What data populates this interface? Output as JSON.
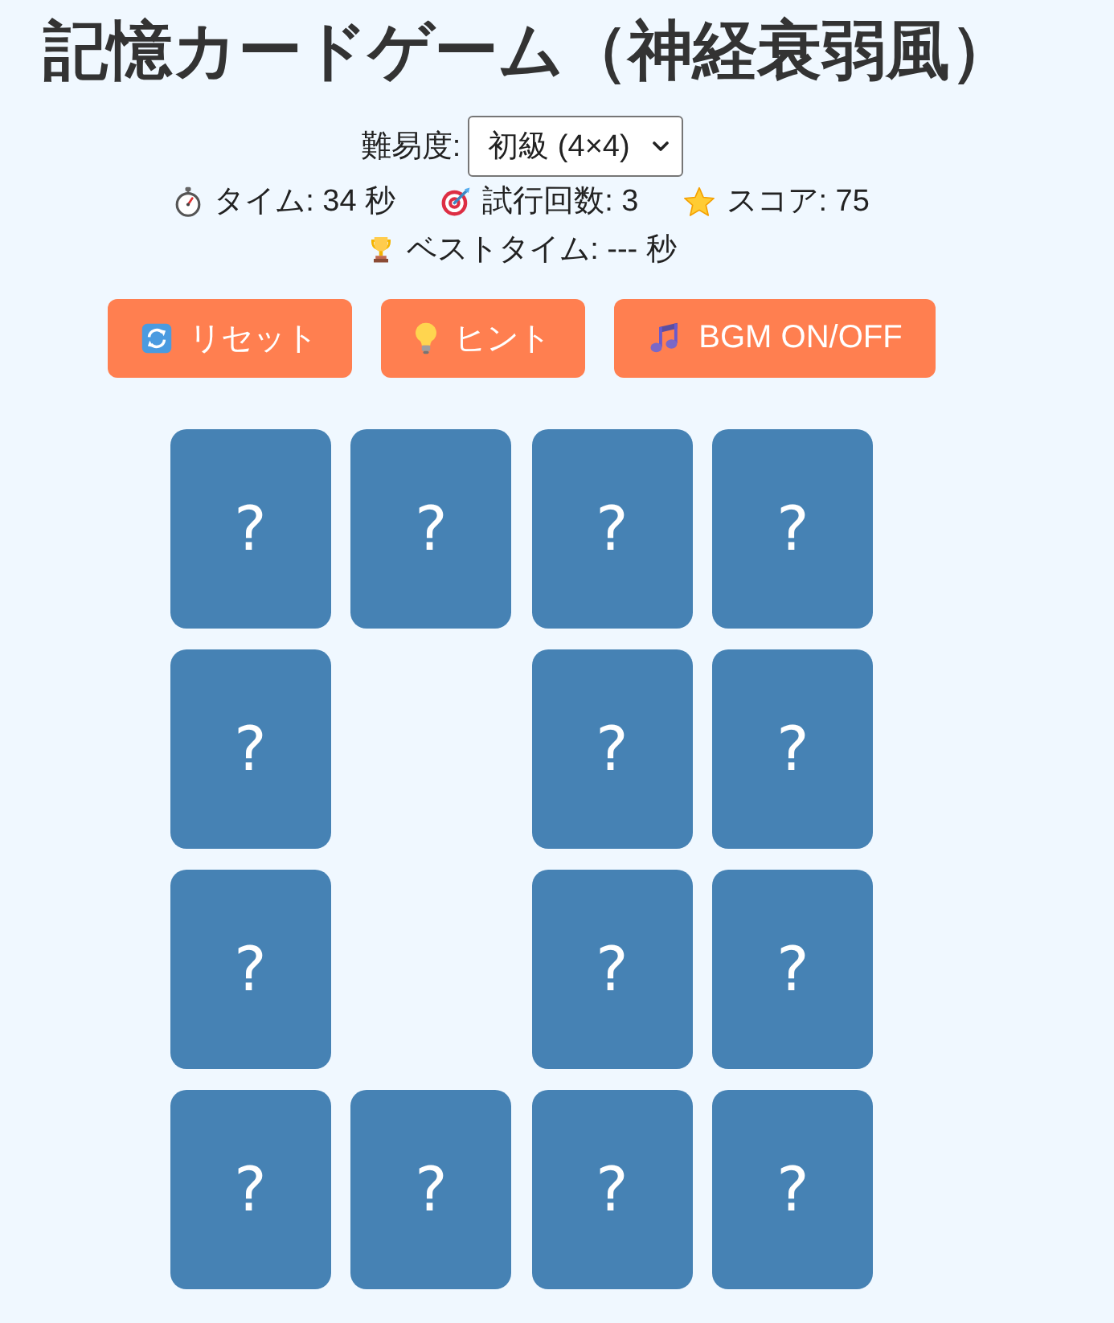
{
  "title": "記憶カードゲーム（神経衰弱風）",
  "difficulty": {
    "label": "難易度:",
    "value": "初級 (4×4)"
  },
  "stats": [
    {
      "items": [
        {
          "kind": "time",
          "text": "タイム: 34 秒"
        },
        {
          "kind": "tries",
          "text": "試行回数: 3"
        },
        {
          "kind": "score",
          "text": "スコア: 75"
        }
      ]
    },
    {
      "items": [
        {
          "kind": "best",
          "text": "ベストタイム: --- 秒"
        }
      ]
    }
  ],
  "buttons": [
    {
      "kind": "reset",
      "label": "リセット"
    },
    {
      "kind": "hint",
      "label": "ヒント"
    },
    {
      "kind": "bgm",
      "label": "BGM ON/OFF"
    }
  ],
  "cards": [
    {
      "matched": false,
      "label": "?"
    },
    {
      "matched": false,
      "label": "?"
    },
    {
      "matched": false,
      "label": "?"
    },
    {
      "matched": false,
      "label": "?"
    },
    {
      "matched": false,
      "label": "?"
    },
    {
      "matched": true
    },
    {
      "matched": false,
      "label": "?"
    },
    {
      "matched": false,
      "label": "?"
    },
    {
      "matched": false,
      "label": "?"
    },
    {
      "matched": true
    },
    {
      "matched": false,
      "label": "?"
    },
    {
      "matched": false,
      "label": "?"
    },
    {
      "matched": false,
      "label": "?"
    },
    {
      "matched": false,
      "label": "?"
    },
    {
      "matched": false,
      "label": "?"
    },
    {
      "matched": false,
      "label": "?"
    }
  ]
}
